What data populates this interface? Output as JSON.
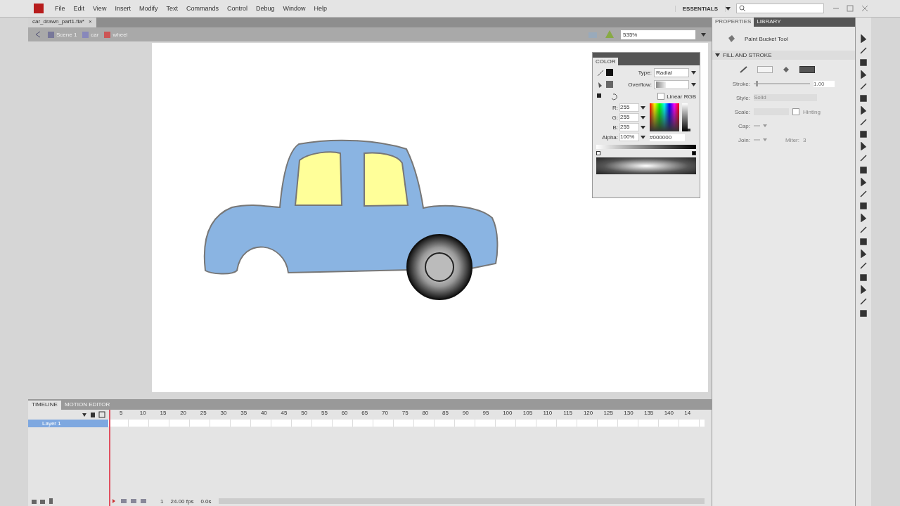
{
  "menu": [
    "File",
    "Edit",
    "View",
    "Insert",
    "Modify",
    "Text",
    "Commands",
    "Control",
    "Debug",
    "Window",
    "Help"
  ],
  "workspace": "ESSENTIALS",
  "document_tab": {
    "title": "car_drawn_part1.fla*",
    "close": "×"
  },
  "breadcrumbs": [
    "Scene 1",
    "car",
    "wheel"
  ],
  "zoom": "535%",
  "color_panel": {
    "title": "COLOR",
    "type_label": "Type:",
    "type": "Radial",
    "overflow_label": "Overflow:",
    "linear_rgb": {
      "label": "Linear RGB",
      "checked": false
    },
    "channels": [
      {
        "label": "R:",
        "value": "255"
      },
      {
        "label": "G:",
        "value": "255"
      },
      {
        "label": "B:",
        "value": "255"
      },
      {
        "label": "Alpha:",
        "value": "100%"
      }
    ],
    "hex": "#000000",
    "brightness": {
      "level": 0
    }
  },
  "properties": {
    "tabs": [
      {
        "label": "PROPERTIES",
        "selected": true
      },
      {
        "label": "LIBRARY",
        "selected": false
      }
    ],
    "tool": "Paint Bucket Tool",
    "section": "FILL AND STROKE",
    "stroke_label": "Stroke:",
    "stroke": "1.00",
    "stroke_slider": {
      "level": 0.04
    },
    "style_label": "Style:",
    "style": "Solid",
    "scale_label": "Scale:",
    "hinting": {
      "label": "Hinting",
      "checked": false
    },
    "cap_label": "Cap:",
    "join_label": "Join:",
    "miter_label": "Miter:",
    "miter": "3"
  },
  "timeline": {
    "tabs": [
      {
        "label": "TIMELINE",
        "selected": true
      },
      {
        "label": "MOTION EDITOR",
        "selected": false
      }
    ],
    "layers": [
      {
        "name": "Layer 1",
        "selected": true
      }
    ],
    "ruler": [
      "5",
      "10",
      "15",
      "20",
      "25",
      "30",
      "35",
      "40",
      "45",
      "50",
      "55",
      "60",
      "65",
      "70",
      "75",
      "80",
      "85",
      "90",
      "95",
      "100",
      "105",
      "110",
      "115",
      "120",
      "125",
      "130",
      "135",
      "140",
      "14"
    ],
    "frame": "1",
    "fps": "24.00 fps",
    "time": "0.0s"
  }
}
